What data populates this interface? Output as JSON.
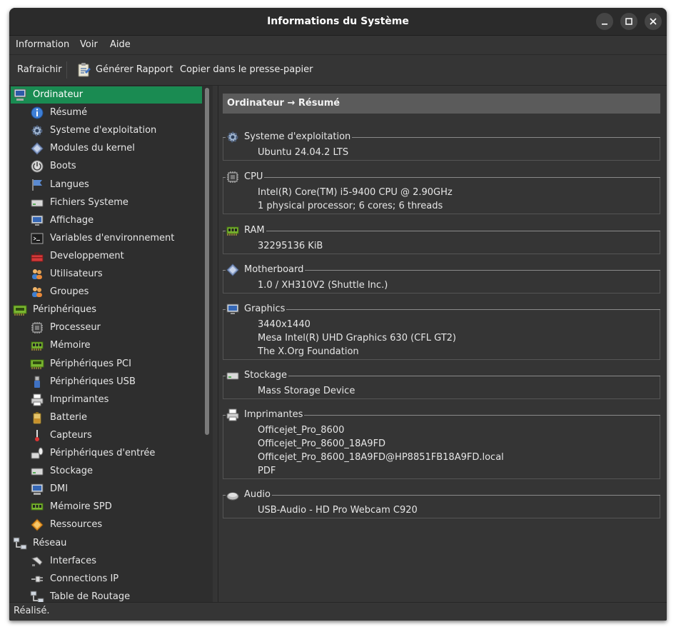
{
  "window": {
    "title": "Informations du Système"
  },
  "menubar": {
    "items": [
      "Information",
      "Voir",
      "Aide"
    ]
  },
  "toolbar": {
    "refresh_label": "Rafraichir",
    "report_label": "Générer Rapport",
    "copy_label": "Copier dans le presse-papier"
  },
  "sidebar": {
    "items": [
      {
        "label": "Ordinateur",
        "icon": "computer-icon",
        "level": 0,
        "selected": true
      },
      {
        "label": "Résumé",
        "icon": "info-icon",
        "level": 1
      },
      {
        "label": "Systeme d'exploitation",
        "icon": "gear-icon",
        "level": 1
      },
      {
        "label": "Modules du kernel",
        "icon": "module-icon",
        "level": 1
      },
      {
        "label": "Boots",
        "icon": "power-icon",
        "level": 1
      },
      {
        "label": "Langues",
        "icon": "flag-icon",
        "level": 1
      },
      {
        "label": "Fichiers Systeme",
        "icon": "drive-icon",
        "level": 1
      },
      {
        "label": "Affichage",
        "icon": "monitor-icon",
        "level": 1
      },
      {
        "label": "Variables d'environnement",
        "icon": "terminal-icon",
        "level": 1
      },
      {
        "label": "Developpement",
        "icon": "toolbox-icon",
        "level": 1
      },
      {
        "label": "Utilisateurs",
        "icon": "users-icon",
        "level": 1
      },
      {
        "label": "Groupes",
        "icon": "group-icon",
        "level": 1
      },
      {
        "label": "Périphériques",
        "icon": "board-icon",
        "level": 0
      },
      {
        "label": "Processeur",
        "icon": "cpu-icon",
        "level": 1
      },
      {
        "label": "Mémoire",
        "icon": "memory-icon",
        "level": 1
      },
      {
        "label": "Périphériques PCI",
        "icon": "pci-icon",
        "level": 1
      },
      {
        "label": "Périphériques USB",
        "icon": "usb-icon",
        "level": 1
      },
      {
        "label": "Imprimantes",
        "icon": "printer-icon",
        "level": 1
      },
      {
        "label": "Batterie",
        "icon": "battery-icon",
        "level": 1
      },
      {
        "label": "Capteurs",
        "icon": "sensor-icon",
        "level": 1
      },
      {
        "label": "Périphériques d'entrée",
        "icon": "input-device-icon",
        "level": 1
      },
      {
        "label": "Stockage",
        "icon": "storage-icon",
        "level": 1
      },
      {
        "label": "DMI",
        "icon": "dmi-icon",
        "level": 1
      },
      {
        "label": "Mémoire SPD",
        "icon": "spd-icon",
        "level": 1
      },
      {
        "label": "Ressources",
        "icon": "resources-icon",
        "level": 1
      },
      {
        "label": "Réseau",
        "icon": "network-icon",
        "level": 0
      },
      {
        "label": "Interfaces",
        "icon": "interface-icon",
        "level": 1
      },
      {
        "label": "Connections IP",
        "icon": "plug-icon",
        "level": 1
      },
      {
        "label": "Table de Routage",
        "icon": "routing-icon",
        "level": 1
      }
    ]
  },
  "content": {
    "breadcrumb": "Ordinateur → Résumé",
    "groups": [
      {
        "title": "Systeme d'exploitation",
        "icon": "gear-icon",
        "values": [
          "Ubuntu 24.04.2 LTS"
        ]
      },
      {
        "title": "CPU",
        "icon": "cpu-icon",
        "values": [
          "Intel(R) Core(TM) i5-9400 CPU @ 2.90GHz",
          "1 physical processor; 6 cores; 6 threads"
        ]
      },
      {
        "title": "RAM",
        "icon": "memory-icon",
        "values": [
          "32295136 KiB"
        ]
      },
      {
        "title": "Motherboard",
        "icon": "module-icon",
        "values": [
          "1.0 / XH310V2 (Shuttle Inc.)"
        ]
      },
      {
        "title": "Graphics",
        "icon": "monitor-icon",
        "values": [
          "3440x1440",
          "Mesa Intel(R) UHD Graphics 630 (CFL GT2)",
          "The X.Org Foundation"
        ]
      },
      {
        "title": "Stockage",
        "icon": "storage-icon",
        "values": [
          "Mass Storage Device"
        ]
      },
      {
        "title": "Imprimantes",
        "icon": "printer-icon",
        "values": [
          "Officejet_Pro_8600",
          "Officejet_Pro_8600_18A9FD",
          "Officejet_Pro_8600_18A9FD@HP8851FB18A9FD.local",
          "PDF"
        ]
      },
      {
        "title": "Audio",
        "icon": "audio-icon",
        "values": [
          "USB-Audio - HD Pro Webcam C920"
        ]
      }
    ]
  },
  "statusbar": {
    "text": "Réalisé."
  },
  "colors": {
    "selection": "#1a8b52",
    "window_bg": "#353535",
    "sidebar_bg": "#2e2e2e",
    "breadcrumb_bg": "#5b5b5b"
  }
}
